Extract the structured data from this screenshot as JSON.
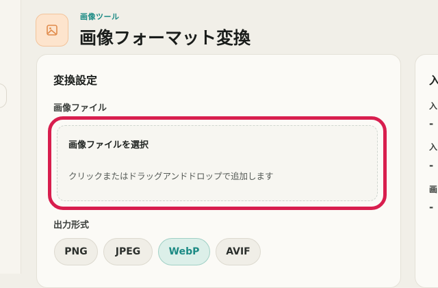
{
  "header": {
    "eyebrow": "画像ツール",
    "title": "画像フォーマット変換",
    "icon": "image-icon"
  },
  "settings": {
    "title": "変換設定",
    "file_label": "画像ファイル",
    "dropzone": {
      "title": "画像ファイルを選択",
      "hint": "クリックまたはドラッグアンドドロップで追加します"
    },
    "output_label": "出力形式",
    "formats": [
      {
        "label": "PNG",
        "selected": false
      },
      {
        "label": "JPEG",
        "selected": false
      },
      {
        "label": "WebP",
        "selected": true
      },
      {
        "label": "AVIF",
        "selected": false
      }
    ]
  },
  "right_panel": {
    "title_partial": "入",
    "rows": [
      {
        "label": "入",
        "value": "-"
      },
      {
        "label": "入",
        "value": "-"
      },
      {
        "label": "画",
        "value": "-"
      }
    ]
  },
  "colors": {
    "accent": "#1b8a84",
    "highlight": "#d81e4e",
    "icon_bg": "#fde4cd",
    "icon_stroke": "#e08a4a"
  }
}
